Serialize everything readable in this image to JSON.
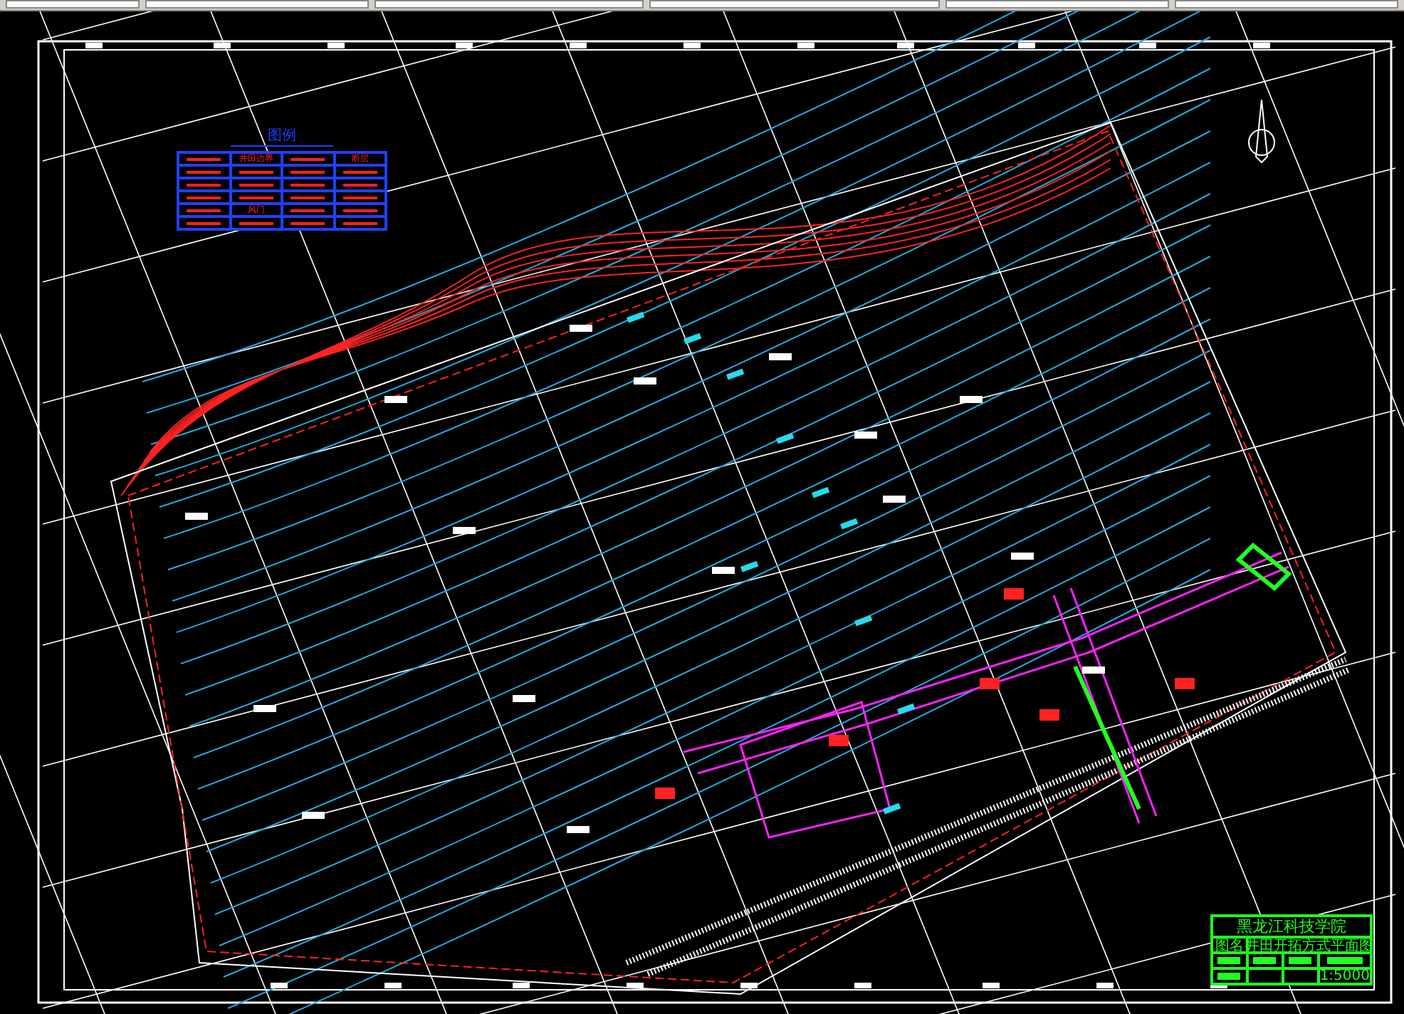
{
  "legend": {
    "title": "图例",
    "rows": [
      [
        "",
        "井田边界",
        "",
        "断层"
      ],
      [
        "",
        "",
        "",
        ""
      ],
      [
        "",
        "",
        "",
        ""
      ],
      [
        "",
        "",
        "",
        ""
      ],
      [
        "",
        "风门",
        "",
        ""
      ],
      [
        "",
        "",
        "",
        ""
      ]
    ]
  },
  "title_block": {
    "school": "黑龙江科技学院",
    "name_label": "图名",
    "drawing_name": "井田开拓方式平面图",
    "scale": "1:5000"
  }
}
